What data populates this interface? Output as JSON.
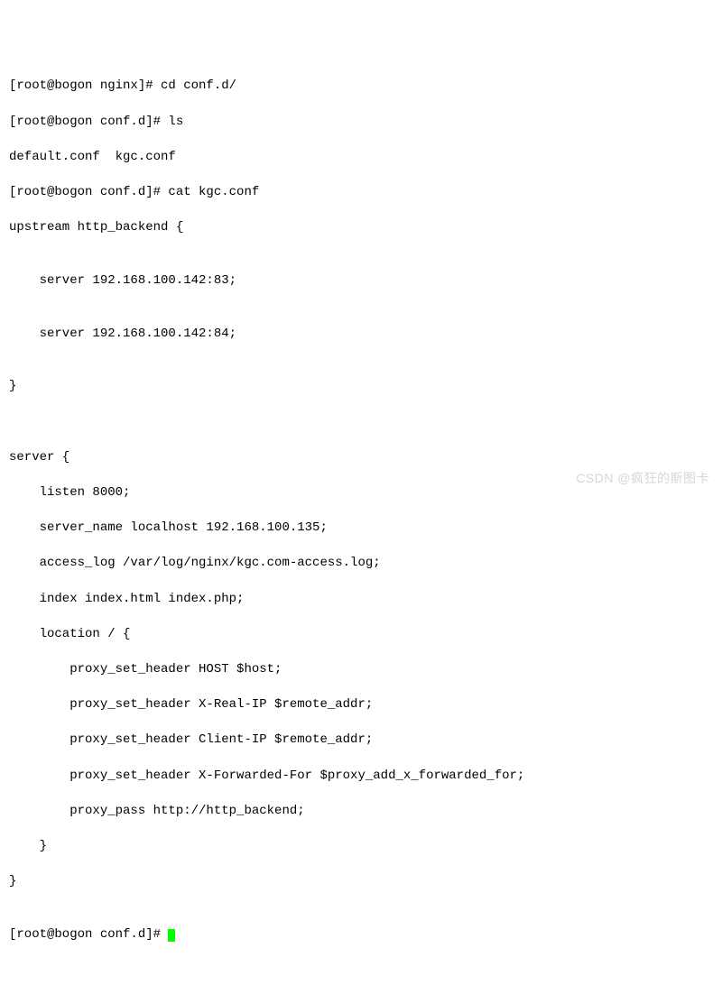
{
  "terminal": {
    "lines": {
      "l0": "[root@bogon nginx]# cd conf.d/",
      "l1": "[root@bogon conf.d]# ls",
      "l2": "default.conf  kgc.conf",
      "l3": "[root@bogon conf.d]# cat kgc.conf",
      "l4": "upstream http_backend {",
      "l5": "",
      "l6": "    server 192.168.100.142:83;",
      "l7": "",
      "l8": "    server 192.168.100.142:84;",
      "l9": "",
      "l10": "}",
      "l11": "",
      "l12": "",
      "l13": "server {",
      "l14": "    listen 8000;",
      "l15": "    server_name localhost 192.168.100.135;",
      "l16": "    access_log /var/log/nginx/kgc.com-access.log;",
      "l17": "    index index.html index.php;",
      "l18": "    location / {",
      "l19": "        proxy_set_header HOST $host;",
      "l20": "        proxy_set_header X-Real-IP $remote_addr;",
      "l21": "        proxy_set_header Client-IP $remote_addr;",
      "l22": "        proxy_set_header X-Forwarded-For $proxy_add_x_forwarded_for;",
      "l23": "        proxy_pass http://http_backend;",
      "l24": "    }",
      "l25": "}",
      "l26": "",
      "l27_prompt": "[root@bogon conf.d]# "
    }
  },
  "watermark": "CSDN @疯狂的斯图卡"
}
